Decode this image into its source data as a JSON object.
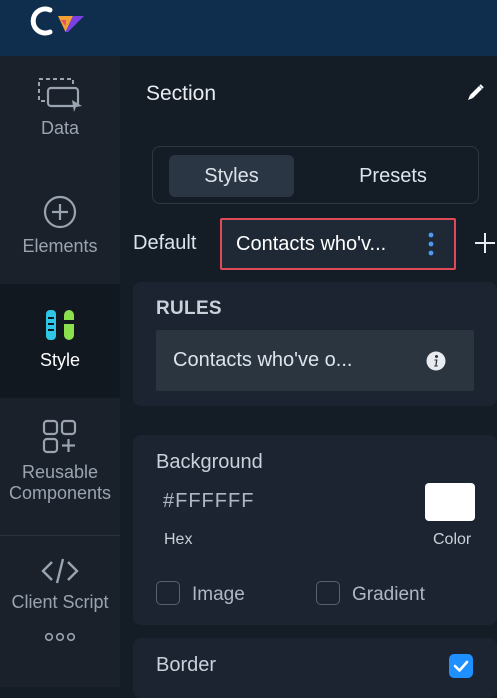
{
  "rail": {
    "items": [
      {
        "label": "Data",
        "icon": "data-icon"
      },
      {
        "label": "Elements",
        "icon": "plus-circle-icon"
      },
      {
        "label": "Style",
        "icon": "style-icon"
      },
      {
        "label": "Reusable Components",
        "icon": "components-icon"
      },
      {
        "label": "Client Script",
        "icon": "code-icon"
      }
    ],
    "more_icon": "more-dots-icon"
  },
  "panel": {
    "title": "Section",
    "tabs": [
      "Styles",
      "Presets"
    ],
    "active_tab": "Styles",
    "default_label": "Default",
    "chip_label": "Contacts who'v...",
    "rules": {
      "title": "RULES",
      "rule_text": "Contacts who've o..."
    },
    "background": {
      "title": "Background",
      "hex_value": "#FFFFFF",
      "hex_label": "Hex",
      "color_label": "Color",
      "image_label": "Image",
      "gradient_label": "Gradient",
      "image_checked": false,
      "gradient_checked": false
    },
    "border": {
      "title": "Border",
      "checked": true
    }
  },
  "colors": {
    "accent": "#1e90ff",
    "highlight": "#e04a55",
    "topbar": "#0f2e4d"
  }
}
